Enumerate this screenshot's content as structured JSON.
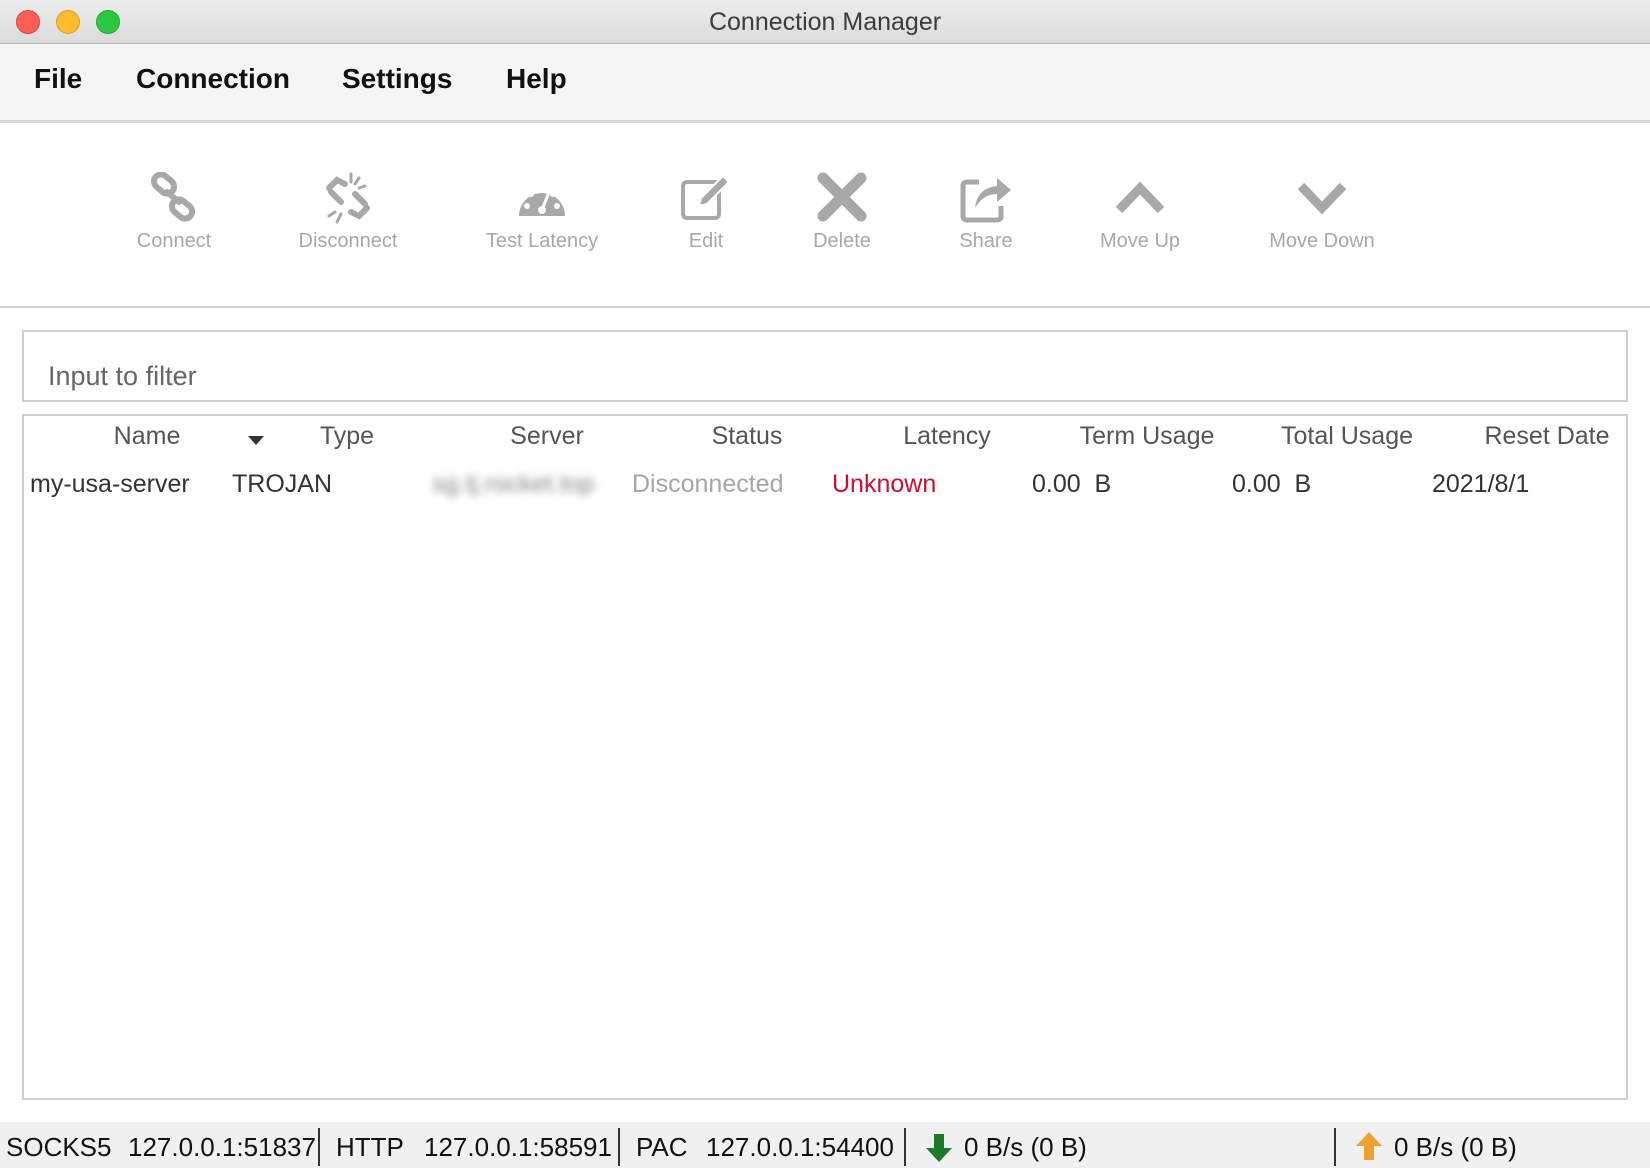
{
  "window": {
    "title": "Connection Manager"
  },
  "menu": [
    {
      "label": "File"
    },
    {
      "label": "Connection"
    },
    {
      "label": "Settings"
    },
    {
      "label": "Help"
    }
  ],
  "toolbar": {
    "connect": {
      "label": "Connect",
      "icon": "link-icon"
    },
    "disconnect": {
      "label": "Disconnect",
      "icon": "broken-link-icon"
    },
    "test_latency": {
      "label": "Test Latency",
      "icon": "speedometer-icon"
    },
    "edit": {
      "label": "Edit",
      "icon": "edit-icon"
    },
    "delete": {
      "label": "Delete",
      "icon": "x-icon"
    },
    "share": {
      "label": "Share",
      "icon": "share-icon"
    },
    "move_up": {
      "label": "Move Up",
      "icon": "chevron-up-icon"
    },
    "move_down": {
      "label": "Move Down",
      "icon": "chevron-down-icon"
    }
  },
  "filter": {
    "placeholder": "Input to filter",
    "value": ""
  },
  "table": {
    "columns": [
      "Name",
      "Type",
      "Server",
      "Status",
      "Latency",
      "Term Usage",
      "Total Usage",
      "Reset Date"
    ],
    "sort_column": "Name",
    "rows": [
      {
        "name": "my-usa-server",
        "type": "TROJAN",
        "server": "sg.tj.rocket.top",
        "status": "Disconnected",
        "latency": "Unknown",
        "term_usage": "0.00  B",
        "total_usage": "0.00  B",
        "reset_date": "2021/8/1"
      }
    ]
  },
  "statusbar": {
    "socks5_label": "SOCKS5",
    "socks5_addr": "127.0.0.1:51837",
    "http_label": "HTTP",
    "http_addr": "127.0.0.1:58591",
    "pac_label": "PAC",
    "pac_addr": "127.0.0.1:54400",
    "download": "0 B/s (0 B)",
    "upload": "0 B/s (0 B)"
  },
  "colors": {
    "latency_unknown": "#c8102e",
    "download_arrow": "#1e7b2a",
    "upload_arrow": "#f0a030",
    "disabled_tool": "#a8a8a8"
  }
}
